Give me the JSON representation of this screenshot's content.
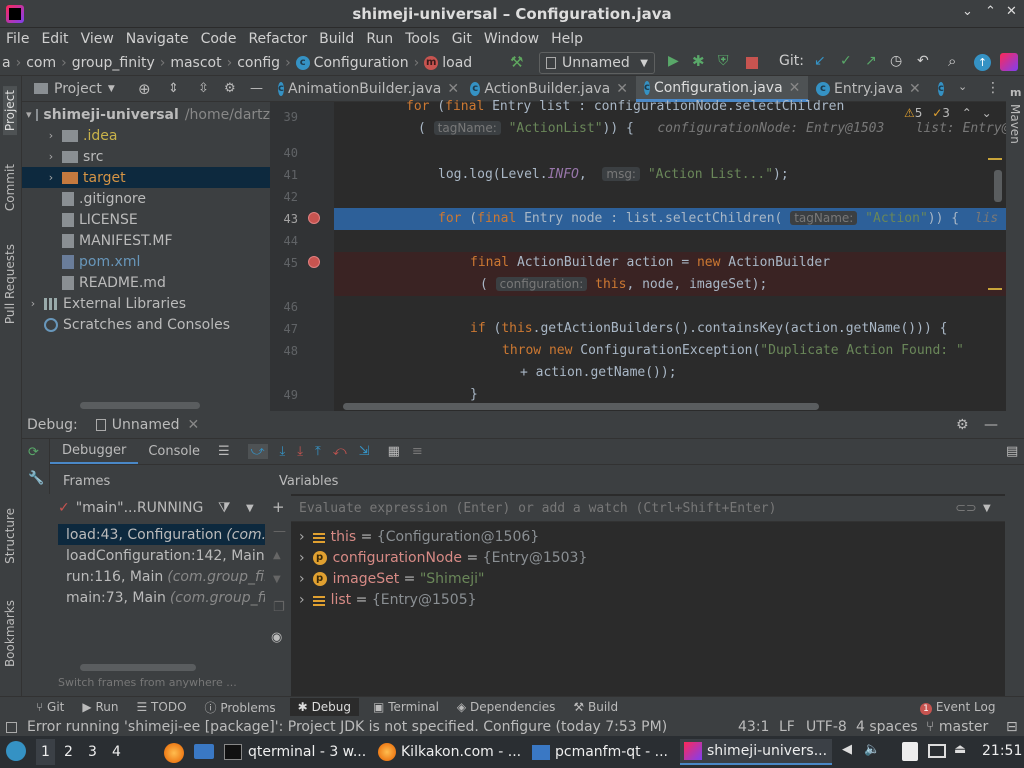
{
  "window": {
    "title": "shimeji-universal – Configuration.java"
  },
  "menu": [
    "File",
    "Edit",
    "View",
    "Navigate",
    "Code",
    "Refactor",
    "Build",
    "Run",
    "Tools",
    "Git",
    "Window",
    "Help"
  ],
  "nav": {
    "crumbs": [
      "a",
      "com",
      "group_finity",
      "mascot",
      "config",
      "Configuration",
      "load"
    ],
    "run_config": "Unnamed",
    "git_label": "Git:"
  },
  "side_tabs": {
    "left_top": [
      "Project",
      "Commit",
      "Pull Requests"
    ],
    "left_bottom": [
      "Structure",
      "Bookmarks"
    ],
    "right": [
      "Maven"
    ]
  },
  "project": {
    "header": "Project",
    "items": [
      {
        "label": "shimeji-universal",
        "extra": "/home/dartz",
        "arrow": "▾",
        "indent": 0,
        "type": "root"
      },
      {
        "label": ".idea",
        "arrow": "›",
        "indent": 1,
        "type": "folder"
      },
      {
        "label": "src",
        "arrow": "›",
        "indent": 1,
        "type": "folder"
      },
      {
        "label": "target",
        "arrow": "›",
        "indent": 1,
        "type": "folder-orange",
        "selected": true
      },
      {
        "label": ".gitignore",
        "arrow": "",
        "indent": 1,
        "type": "file"
      },
      {
        "label": "LICENSE",
        "arrow": "",
        "indent": 1,
        "type": "file"
      },
      {
        "label": "MANIFEST.MF",
        "arrow": "",
        "indent": 1,
        "type": "file"
      },
      {
        "label": "pom.xml",
        "arrow": "",
        "indent": 1,
        "type": "xml"
      },
      {
        "label": "README.md",
        "arrow": "",
        "indent": 1,
        "type": "file"
      },
      {
        "label": "External Libraries",
        "arrow": "›",
        "indent": 0,
        "type": "lib"
      },
      {
        "label": "Scratches and Consoles",
        "arrow": "",
        "indent": 0,
        "type": "scratch"
      }
    ]
  },
  "editor": {
    "tabs": [
      {
        "label": "AnimationBuilder.java",
        "active": false
      },
      {
        "label": "ActionBuilder.java",
        "active": false
      },
      {
        "label": "Configuration.java",
        "active": true
      },
      {
        "label": "Entry.java",
        "active": false
      }
    ],
    "warnings": "5",
    "errors": "3",
    "line_numbers": [
      "39",
      "",
      "40",
      "41",
      "42",
      "43",
      "44",
      "45",
      "",
      "46",
      "47",
      "48",
      "",
      "49"
    ]
  },
  "debug": {
    "label": "Debug:",
    "session": "Unnamed",
    "tabs": [
      "Debugger",
      "Console"
    ],
    "frames_header": "Frames",
    "variables_header": "Variables",
    "thread": "\"main\"...RUNNING",
    "frames": [
      {
        "method": "load:43, Configuration",
        "cls": "(com.gr"
      },
      {
        "method": "loadConfiguration:142, Main",
        "cls": "(c"
      },
      {
        "method": "run:116, Main",
        "cls": "(com.group_finit"
      },
      {
        "method": "main:73, Main",
        "cls": "(com.group_fini"
      }
    ],
    "switch_hint": "Switch frames from anywhere ...",
    "eval_placeholder": "Evaluate expression (Enter) or add a watch (Ctrl+Shift+Enter)",
    "variables": [
      {
        "name": "this",
        "value": "{Configuration@1506}",
        "kind": "field"
      },
      {
        "name": "configurationNode",
        "value": "{Entry@1503}",
        "kind": "param"
      },
      {
        "name": "imageSet",
        "value": "\"Shimeji\"",
        "kind": "param"
      },
      {
        "name": "list",
        "value": "{Entry@1505}",
        "kind": "field"
      }
    ]
  },
  "toolwindows": [
    "Git",
    "Run",
    "TODO",
    "Problems",
    "Debug",
    "Terminal",
    "Dependencies",
    "Build"
  ],
  "event_log": "Event Log",
  "status": {
    "message": "Error running 'shimeji-ee [package]': Project JDK is not specified. Configure (today 7:53 PM)",
    "position": "43:1",
    "line_sep": "LF",
    "encoding": "UTF-8",
    "indent": "4 spaces",
    "branch": "master"
  },
  "taskbar": {
    "workspaces": [
      "1",
      "2",
      "3",
      "4"
    ],
    "tasks": [
      "qterminal - 3 w...",
      "Kilkakon.com - ...",
      "pcmanfm-qt - ...",
      "shimeji-univers..."
    ],
    "clock": "21:51"
  },
  "colors": {
    "accent": "#4a88c7",
    "breakpoint": "#c75450",
    "keyword": "#cc7832",
    "string": "#6a8759"
  }
}
